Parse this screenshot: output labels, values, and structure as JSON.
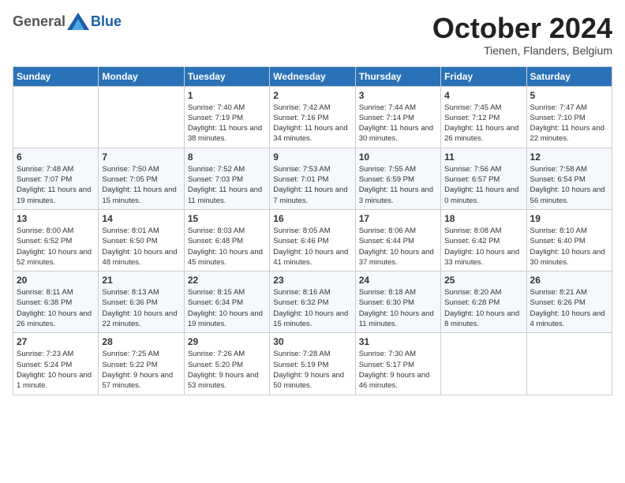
{
  "header": {
    "logo_general": "General",
    "logo_blue": "Blue",
    "month": "October 2024",
    "location": "Tienen, Flanders, Belgium"
  },
  "days_of_week": [
    "Sunday",
    "Monday",
    "Tuesday",
    "Wednesday",
    "Thursday",
    "Friday",
    "Saturday"
  ],
  "weeks": [
    [
      {
        "day": "",
        "info": ""
      },
      {
        "day": "",
        "info": ""
      },
      {
        "day": "1",
        "info": "Sunrise: 7:40 AM\nSunset: 7:19 PM\nDaylight: 11 hours and 38 minutes."
      },
      {
        "day": "2",
        "info": "Sunrise: 7:42 AM\nSunset: 7:16 PM\nDaylight: 11 hours and 34 minutes."
      },
      {
        "day": "3",
        "info": "Sunrise: 7:44 AM\nSunset: 7:14 PM\nDaylight: 11 hours and 30 minutes."
      },
      {
        "day": "4",
        "info": "Sunrise: 7:45 AM\nSunset: 7:12 PM\nDaylight: 11 hours and 26 minutes."
      },
      {
        "day": "5",
        "info": "Sunrise: 7:47 AM\nSunset: 7:10 PM\nDaylight: 11 hours and 22 minutes."
      }
    ],
    [
      {
        "day": "6",
        "info": "Sunrise: 7:48 AM\nSunset: 7:07 PM\nDaylight: 11 hours and 19 minutes."
      },
      {
        "day": "7",
        "info": "Sunrise: 7:50 AM\nSunset: 7:05 PM\nDaylight: 11 hours and 15 minutes."
      },
      {
        "day": "8",
        "info": "Sunrise: 7:52 AM\nSunset: 7:03 PM\nDaylight: 11 hours and 11 minutes."
      },
      {
        "day": "9",
        "info": "Sunrise: 7:53 AM\nSunset: 7:01 PM\nDaylight: 11 hours and 7 minutes."
      },
      {
        "day": "10",
        "info": "Sunrise: 7:55 AM\nSunset: 6:59 PM\nDaylight: 11 hours and 3 minutes."
      },
      {
        "day": "11",
        "info": "Sunrise: 7:56 AM\nSunset: 6:57 PM\nDaylight: 11 hours and 0 minutes."
      },
      {
        "day": "12",
        "info": "Sunrise: 7:58 AM\nSunset: 6:54 PM\nDaylight: 10 hours and 56 minutes."
      }
    ],
    [
      {
        "day": "13",
        "info": "Sunrise: 8:00 AM\nSunset: 6:52 PM\nDaylight: 10 hours and 52 minutes."
      },
      {
        "day": "14",
        "info": "Sunrise: 8:01 AM\nSunset: 6:50 PM\nDaylight: 10 hours and 48 minutes."
      },
      {
        "day": "15",
        "info": "Sunrise: 8:03 AM\nSunset: 6:48 PM\nDaylight: 10 hours and 45 minutes."
      },
      {
        "day": "16",
        "info": "Sunrise: 8:05 AM\nSunset: 6:46 PM\nDaylight: 10 hours and 41 minutes."
      },
      {
        "day": "17",
        "info": "Sunrise: 8:06 AM\nSunset: 6:44 PM\nDaylight: 10 hours and 37 minutes."
      },
      {
        "day": "18",
        "info": "Sunrise: 8:08 AM\nSunset: 6:42 PM\nDaylight: 10 hours and 33 minutes."
      },
      {
        "day": "19",
        "info": "Sunrise: 8:10 AM\nSunset: 6:40 PM\nDaylight: 10 hours and 30 minutes."
      }
    ],
    [
      {
        "day": "20",
        "info": "Sunrise: 8:11 AM\nSunset: 6:38 PM\nDaylight: 10 hours and 26 minutes."
      },
      {
        "day": "21",
        "info": "Sunrise: 8:13 AM\nSunset: 6:36 PM\nDaylight: 10 hours and 22 minutes."
      },
      {
        "day": "22",
        "info": "Sunrise: 8:15 AM\nSunset: 6:34 PM\nDaylight: 10 hours and 19 minutes."
      },
      {
        "day": "23",
        "info": "Sunrise: 8:16 AM\nSunset: 6:32 PM\nDaylight: 10 hours and 15 minutes."
      },
      {
        "day": "24",
        "info": "Sunrise: 8:18 AM\nSunset: 6:30 PM\nDaylight: 10 hours and 11 minutes."
      },
      {
        "day": "25",
        "info": "Sunrise: 8:20 AM\nSunset: 6:28 PM\nDaylight: 10 hours and 8 minutes."
      },
      {
        "day": "26",
        "info": "Sunrise: 8:21 AM\nSunset: 6:26 PM\nDaylight: 10 hours and 4 minutes."
      }
    ],
    [
      {
        "day": "27",
        "info": "Sunrise: 7:23 AM\nSunset: 5:24 PM\nDaylight: 10 hours and 1 minute."
      },
      {
        "day": "28",
        "info": "Sunrise: 7:25 AM\nSunset: 5:22 PM\nDaylight: 9 hours and 57 minutes."
      },
      {
        "day": "29",
        "info": "Sunrise: 7:26 AM\nSunset: 5:20 PM\nDaylight: 9 hours and 53 minutes."
      },
      {
        "day": "30",
        "info": "Sunrise: 7:28 AM\nSunset: 5:19 PM\nDaylight: 9 hours and 50 minutes."
      },
      {
        "day": "31",
        "info": "Sunrise: 7:30 AM\nSunset: 5:17 PM\nDaylight: 9 hours and 46 minutes."
      },
      {
        "day": "",
        "info": ""
      },
      {
        "day": "",
        "info": ""
      }
    ]
  ]
}
